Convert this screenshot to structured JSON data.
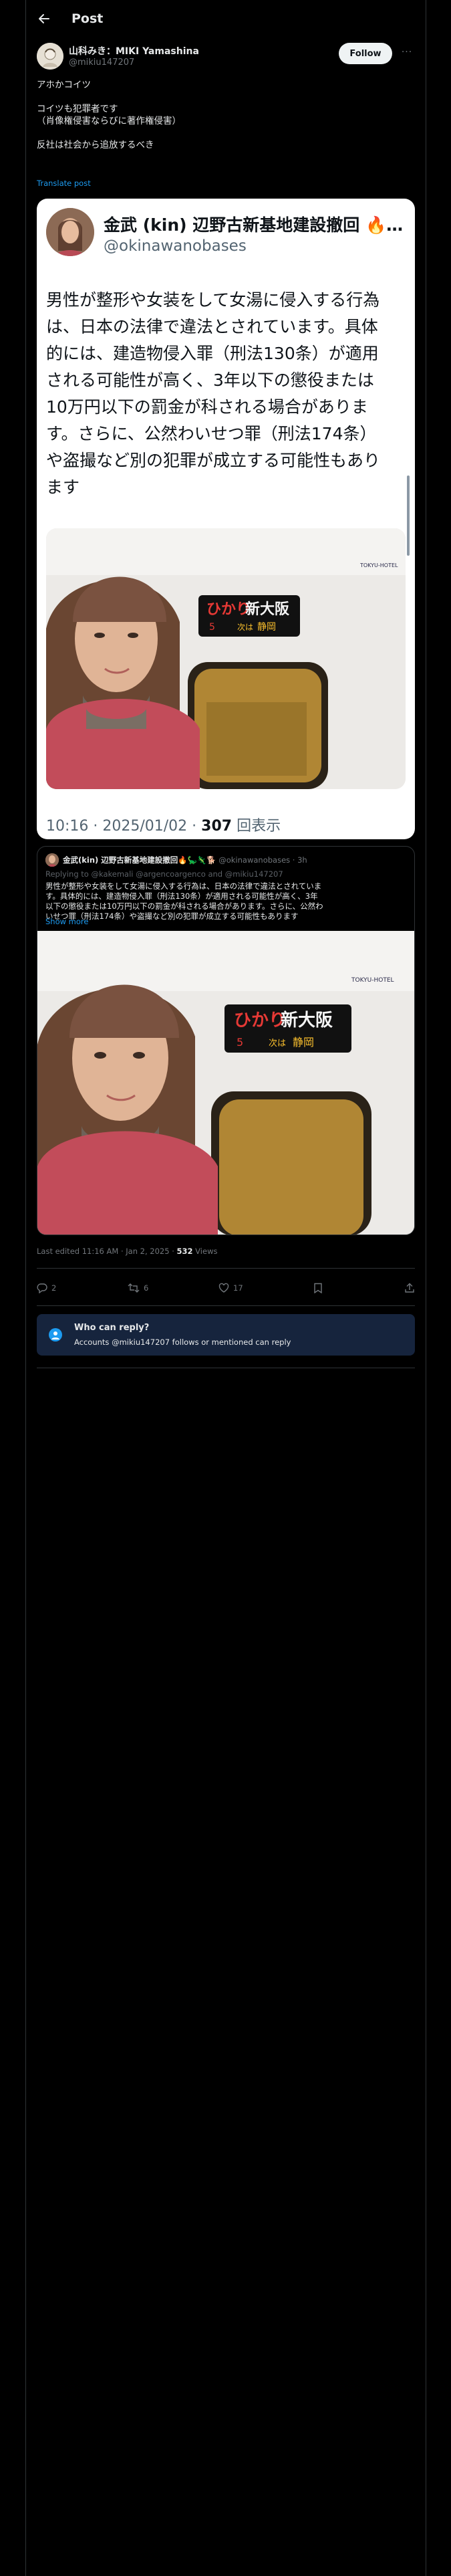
{
  "header": {
    "title": "Post"
  },
  "author": {
    "name": "山科みき：MIKI Yamashina",
    "handle": "@mikiu147207",
    "follow_label": "Follow",
    "more_label": "···"
  },
  "post": {
    "lines": [
      "アホかコイツ",
      "",
      "コイツも犯罪者です",
      "（肖像権侵害ならびに著作権侵害）",
      "",
      "反社は社会から追放するべき"
    ],
    "translate_label": "Translate post"
  },
  "embed_large": {
    "name": "金武 (kin) 辺野古新基地建設撤回 🔥…",
    "handle": "@okinawanobases",
    "body_lines": [
      "男性が整形や女装をして女湯に侵入する行為",
      "は、日本の法律で違法とされています。具体",
      "的には、建造物侵入罪（刑法130条）が適用",
      "される可能性が高く、3年以下の懲役または",
      "10万円以下の罰金が科される場合がありま",
      "す。さらに、公然わいせつ罪（刑法174条）",
      "や盗撮など別の犯罪が成立する可能性もあり",
      "ます"
    ],
    "sign_brand": "TOKYU-HOTEL",
    "sign_train": "ひかり",
    "sign_dest": "新大阪",
    "sign_car": "5",
    "sign_next": "次は",
    "sign_next_station": "静岡",
    "timestamp": "10:16 · 2025/01/02 · ",
    "views_count": "307",
    "views_label": " 回表示"
  },
  "embed_quote": {
    "name": "金武(kin) 辺野古新基地建設撤回🔥🦕🦎🐕",
    "handle_time": " @okinawanobases · 3h",
    "replying_to": "Replying to @kakemali @argencoargenco and @mikiu147207",
    "body_lines": [
      "男性が整形や女装をして女湯に侵入する行為は、日本の法律で違法とされていま",
      "す。具体的には、建造物侵入罪（刑法130条）が適用される可能性が高く、3年",
      "以下の懲役または10万円以下の罰金が科される場合があります。さらに、公然わ",
      "いせつ罪（刑法174条）や盗撮など別の犯罪が成立する可能性もあります"
    ],
    "show_more": "Show more"
  },
  "meta": {
    "edited_text": "Last edited 11:16 AM · Jan 2, 2025 · ",
    "views_count": "532",
    "views_label": " Views"
  },
  "actions": {
    "replies": "2",
    "reposts": "6",
    "likes": "17"
  },
  "reply_notice": {
    "title": "Who can reply?",
    "subtitle": "Accounts @mikiu147207 follows or mentioned can reply"
  }
}
